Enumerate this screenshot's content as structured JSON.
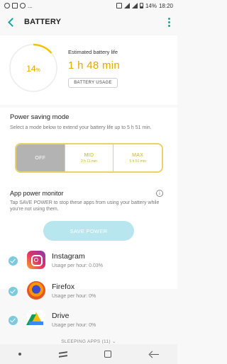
{
  "status_bar": {
    "left_overflow": "...",
    "battery_percent": "14%",
    "time": "18:20"
  },
  "app_bar": {
    "title": "BATTERY"
  },
  "battery": {
    "percent_number": "14",
    "percent_sign": "%",
    "level_fraction": 0.14,
    "estimated_label": "Estimated battery life",
    "estimated_value": "1 h 48 min",
    "usage_button": "BATTERY USAGE"
  },
  "power_saving": {
    "title": "Power saving mode",
    "description": "Select a mode below to extend your battery life up to 5 h 51 min.",
    "modes": [
      {
        "name": "OFF",
        "sub": "",
        "active": true
      },
      {
        "name": "MID",
        "sub": "2 h 11 min",
        "active": false
      },
      {
        "name": "MAX",
        "sub": "5 h 51 min",
        "active": false
      }
    ]
  },
  "app_power_monitor": {
    "title": "App power monitor",
    "info_glyph": "i",
    "description": "Tap SAVE POWER to stop these apps from using your battery while you're not using them.",
    "save_button": "SAVE POWER",
    "apps": [
      {
        "name": "Instagram",
        "usage": "Usage per hour: 0.03%",
        "icon": "instagram-icon",
        "checked": true
      },
      {
        "name": "Firefox",
        "usage": "Usage per hour: 0%",
        "icon": "firefox-icon",
        "checked": true
      },
      {
        "name": "Drive",
        "usage": "Usage per hour: 0%",
        "icon": "drive-icon",
        "checked": true
      }
    ],
    "sleeping_apps": "SLEEPING APPS (11) ⌄"
  },
  "colors": {
    "accent": "#1aa3a0",
    "battery_ring": "#f2c200",
    "save_button": "#b7e6ef",
    "mode_border": "#e6d46a"
  }
}
